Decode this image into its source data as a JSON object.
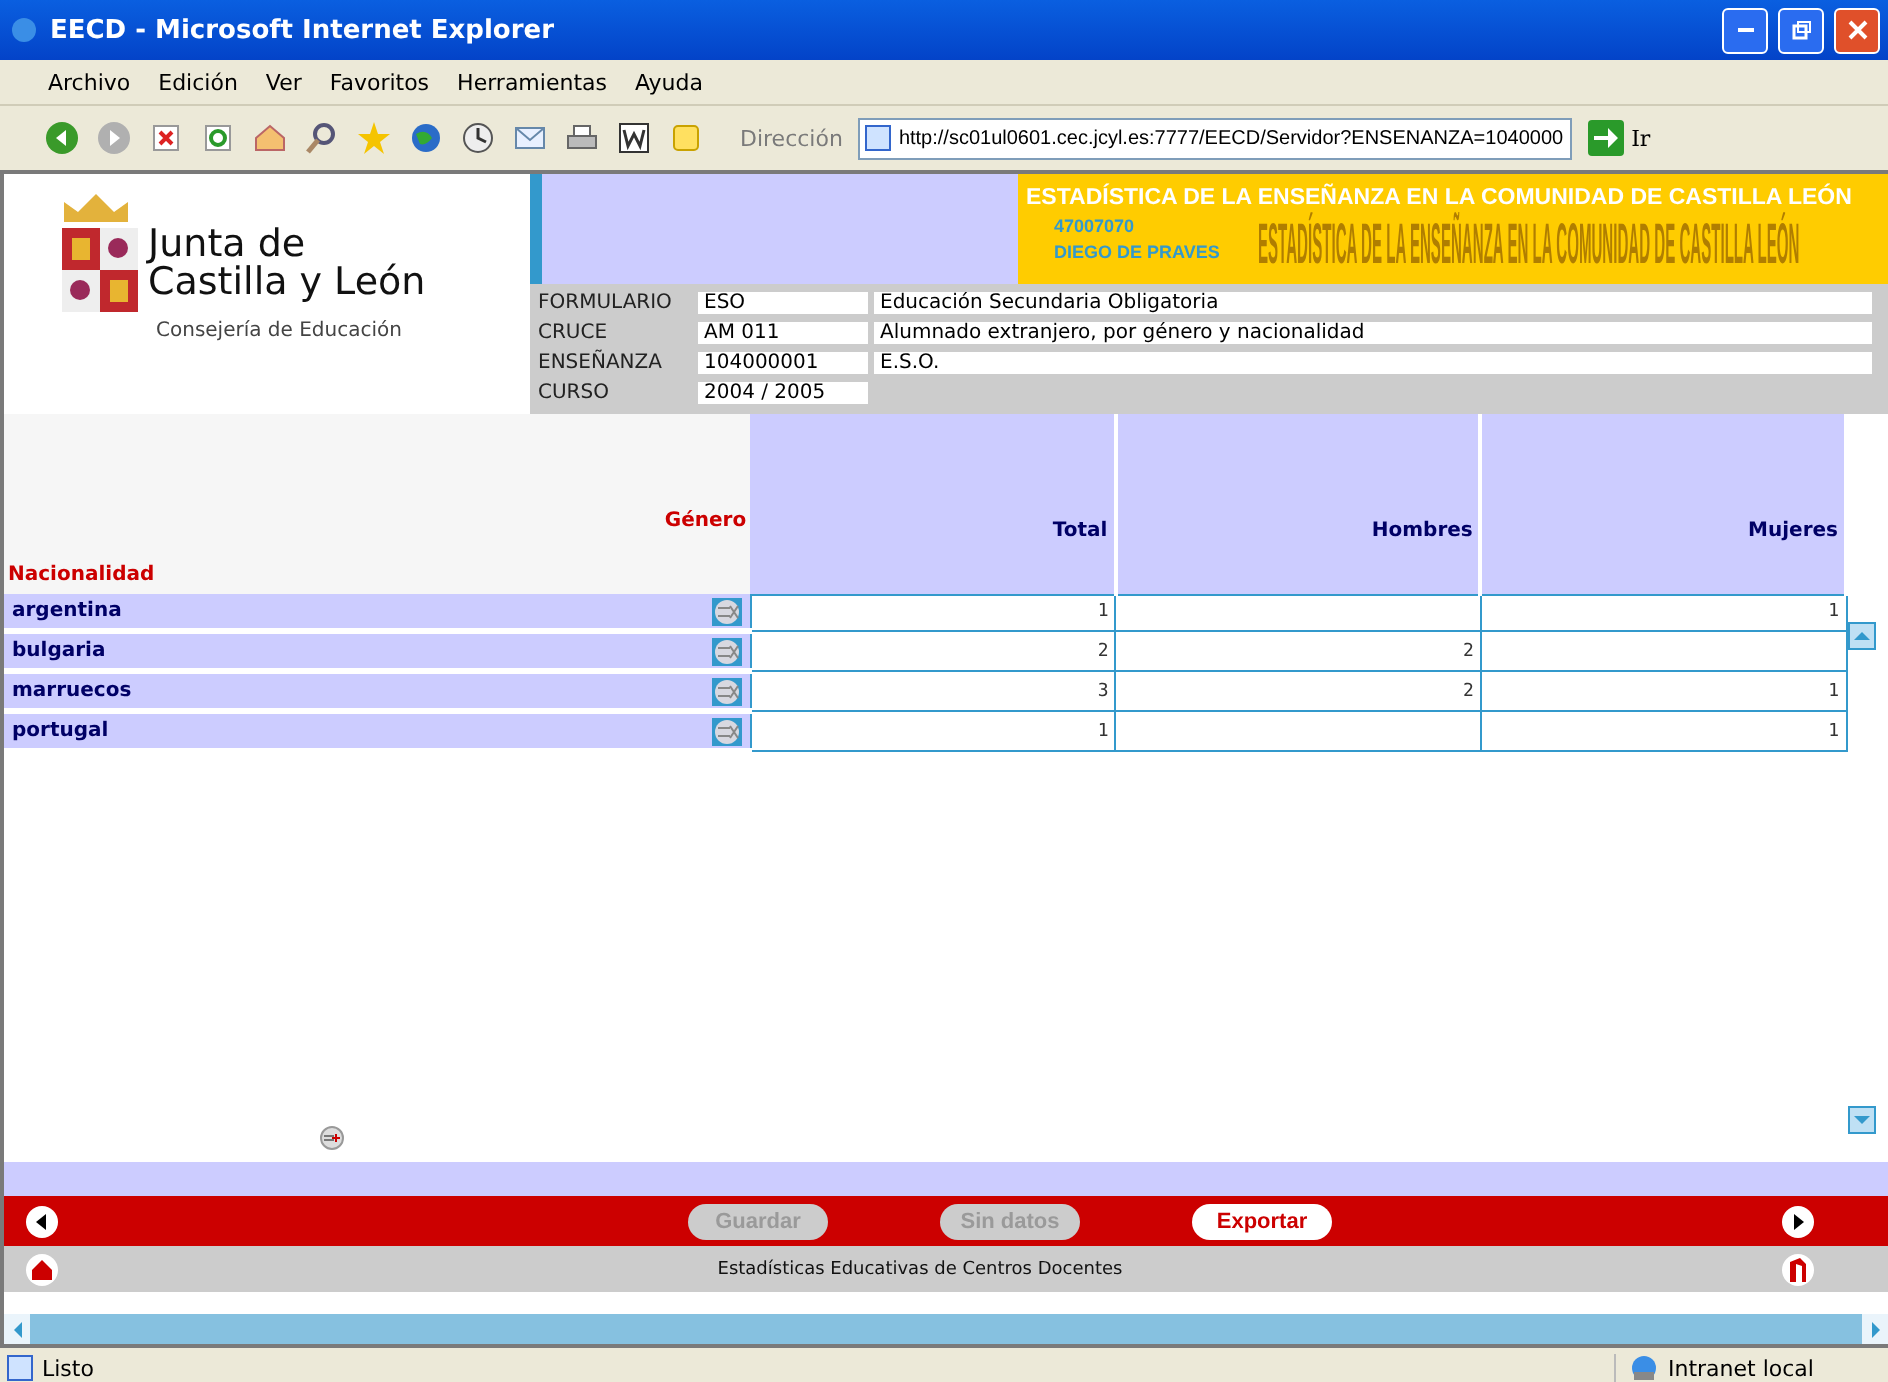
{
  "window": {
    "title": "EECD - Microsoft Internet Explorer"
  },
  "menu": [
    "Archivo",
    "Edición",
    "Ver",
    "Favoritos",
    "Herramientas",
    "Ayuda"
  ],
  "address": {
    "label": "Dirección",
    "value": "http://sc01ul0601.cec.jcyl.es:7777/EECD/Servidor?ENSENANZA=1040000",
    "go": "Ir"
  },
  "logo": {
    "line1": "Junta de",
    "line2": "Castilla y León",
    "subtitle": "Consejería de Educación"
  },
  "banner": {
    "title": "ESTADÍSTICA DE LA ENSEÑANZA EN LA COMUNIDAD DE CASTILLA LEÓN",
    "backdrop": "ESTADÍSTICA DE LA ENSEÑANZA EN LA COMUNIDAD DE CASTILLA LEÓN",
    "code": "47007070",
    "school": "DIEGO DE PRAVES"
  },
  "info": [
    {
      "label": "FORMULARIO",
      "code": "ESO",
      "description": "Educación Secundaria Obligatoria"
    },
    {
      "label": "CRUCE",
      "code": "AM 011",
      "description": "Alumnado extranjero, por género y nacionalidad"
    },
    {
      "label": "ENSEÑANZA",
      "code": "104000001",
      "description": "E.S.O."
    },
    {
      "label": "CURSO",
      "code": "2004 / 2005"
    }
  ],
  "table": {
    "column_header": "Género",
    "row_header": "Nacionalidad",
    "columns": [
      "Total",
      "Hombres",
      "Mujeres"
    ],
    "rows": [
      {
        "name": "argentina",
        "total": "1",
        "women": "1"
      },
      {
        "name": "bulgaria",
        "total": "2",
        "men": "2"
      },
      {
        "name": "marruecos",
        "total": "3",
        "men": "2",
        "women": "1"
      },
      {
        "name": "portugal",
        "total": "1",
        "women": "1"
      }
    ]
  },
  "buttons": [
    {
      "label": "Guardar",
      "disabled": true
    },
    {
      "label": "Sin datos",
      "disabled": true
    },
    {
      "label": "Exportar",
      "disabled": false
    }
  ],
  "footer": "Estadísticas Educativas de Centros Docentes",
  "status_bar": {
    "text": "Listo",
    "zone": "Intranet local"
  }
}
